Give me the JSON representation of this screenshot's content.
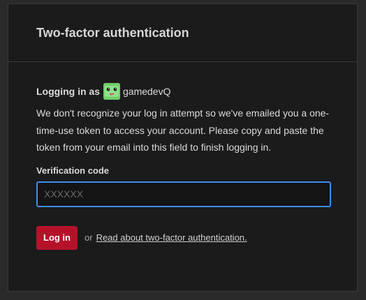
{
  "header": {
    "title": "Two-factor authentication"
  },
  "login": {
    "prefix": "Logging in as",
    "avatar_icon": "frog-avatar-icon",
    "username": "gamedevQ"
  },
  "message": "We don't recognize your log in attempt so we've emailed you a one-time-use token to access your account. Please copy and paste the token from your email into this field to finish logging in.",
  "verification": {
    "label": "Verification code",
    "value": "",
    "placeholder": "XXXXXX"
  },
  "actions": {
    "login_label": "Log in",
    "or_text": "or",
    "link_text": "Read about two-factor authentication."
  },
  "colors": {
    "accent": "#b5122a",
    "focus": "#3b8eea",
    "avatar": "#6fce6a"
  }
}
